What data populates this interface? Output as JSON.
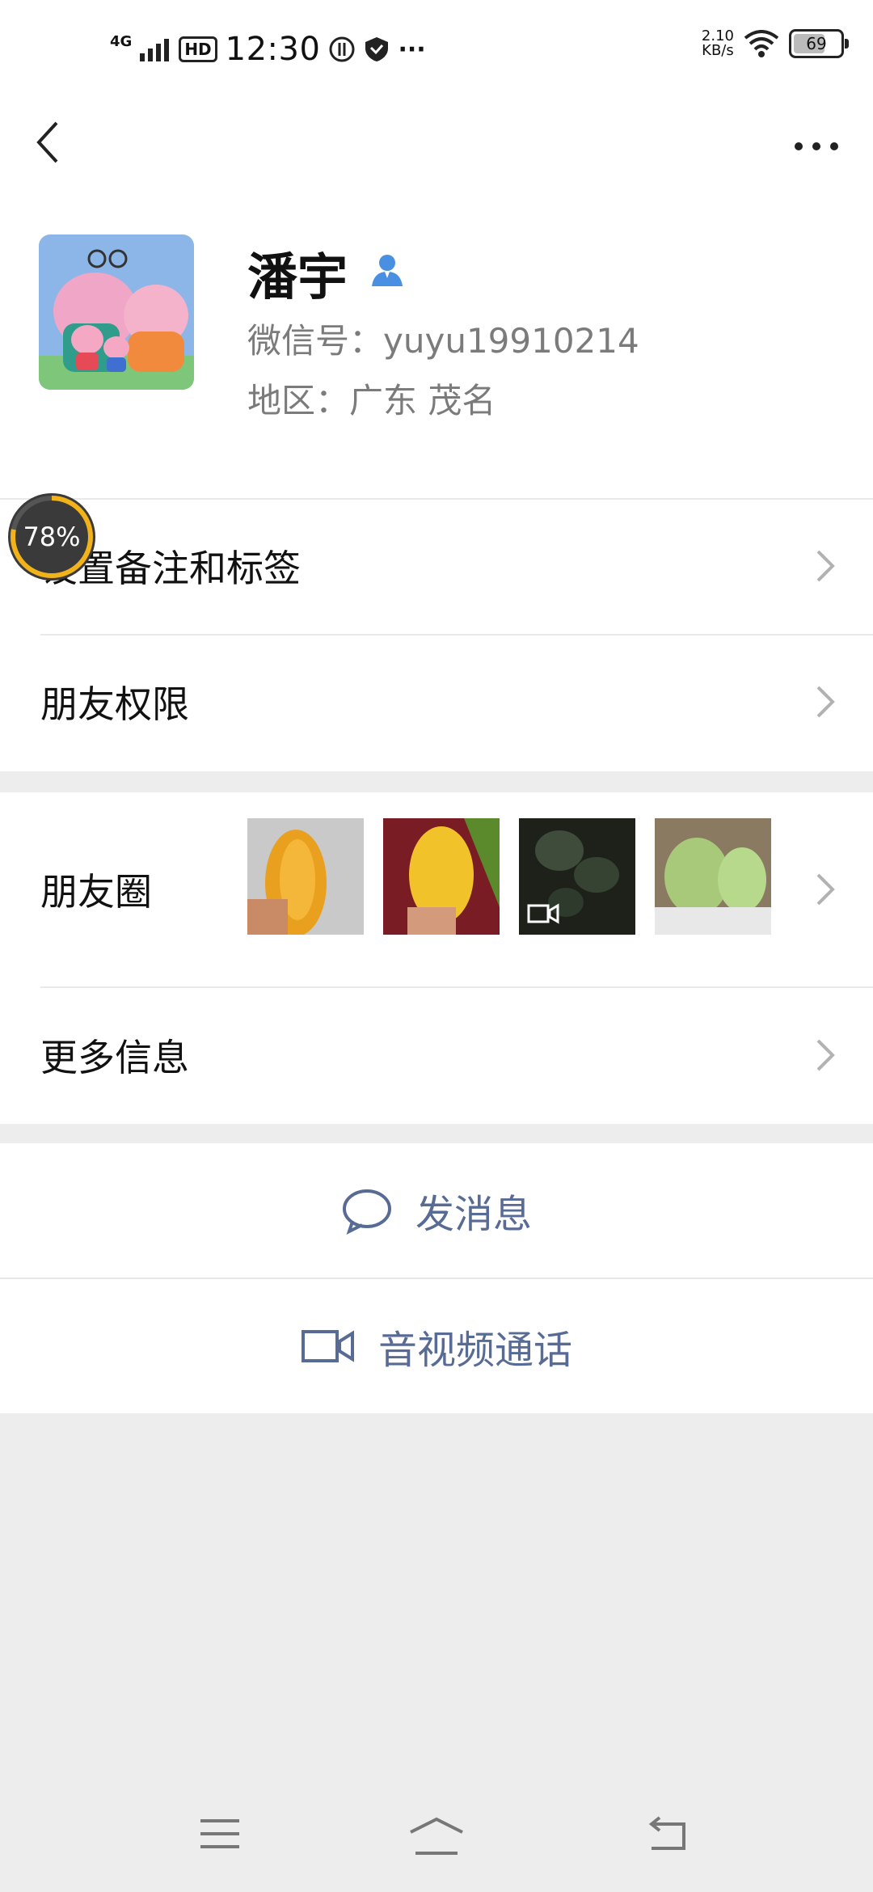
{
  "status_bar": {
    "network": "4G",
    "hd": "HD",
    "time": "12:30",
    "overflow": "···",
    "speed_value": "2.10",
    "speed_unit": "KB/s",
    "battery": "69"
  },
  "header": {
    "back_icon": "chevron-left-icon",
    "more_icon": "more-horizontal-icon"
  },
  "profile": {
    "name": "潘宇",
    "wechat_id": "微信号：yuyu19910214",
    "region": "地区：广东  茂名"
  },
  "menu": {
    "remark_tags": "设置备注和标签",
    "permissions": "朋友权限",
    "moments": "朋友圈",
    "more_info": "更多信息"
  },
  "actions": {
    "message": "发消息",
    "av_call": "音视频通话"
  },
  "floating_progress": "78%",
  "colors": {
    "link": "#576b95",
    "background": "#ededed",
    "verified_icon": "#4a90e2"
  }
}
